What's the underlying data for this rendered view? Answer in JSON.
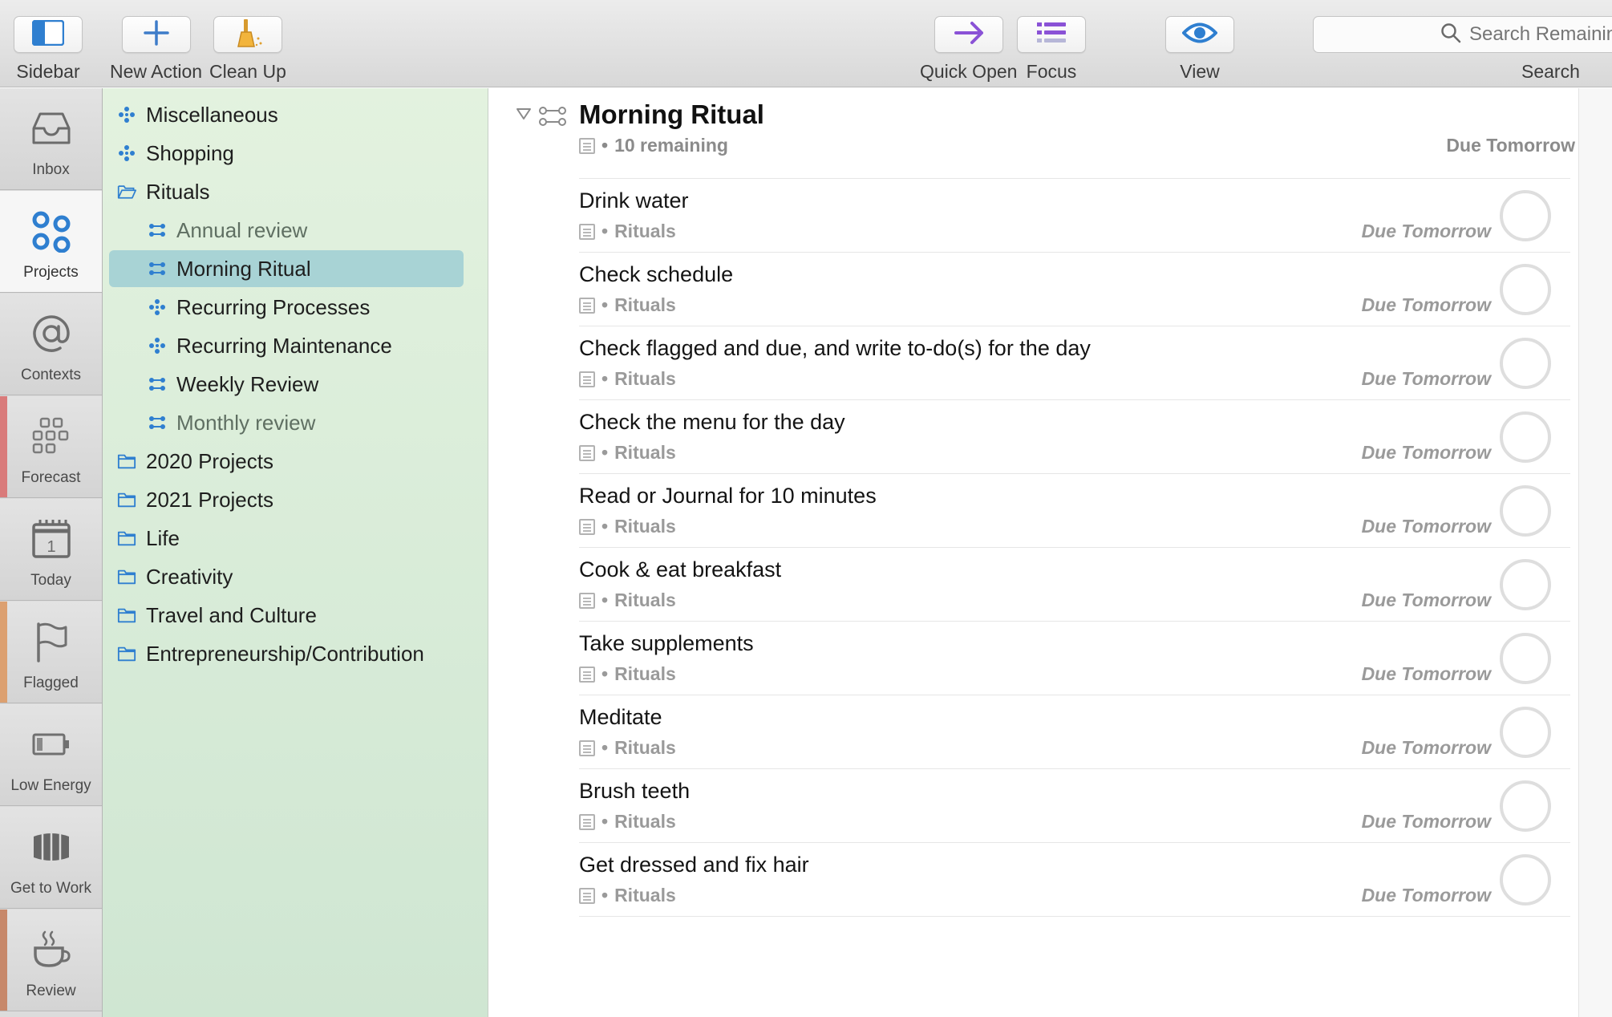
{
  "toolbar": {
    "sidebar_label": "Sidebar",
    "new_action_label": "New Action",
    "clean_up_label": "Clean Up",
    "quick_open_label": "Quick Open",
    "focus_label": "Focus",
    "view_label": "View",
    "search_placeholder": "Search Remaining",
    "search_label": "Search"
  },
  "perspectives": [
    {
      "label": "Inbox",
      "icon": "inbox-icon"
    },
    {
      "label": "Projects",
      "icon": "projects-icon",
      "active": true
    },
    {
      "label": "Contexts",
      "icon": "at-sign-icon"
    },
    {
      "label": "Forecast",
      "icon": "grid-icon",
      "color": "#d97b7b"
    },
    {
      "label": "Today",
      "icon": "calendar-icon"
    },
    {
      "label": "Flagged",
      "icon": "flag-icon",
      "color": "#dca070"
    },
    {
      "label": "Low Energy",
      "icon": "battery-icon"
    },
    {
      "label": "Get to Work",
      "icon": "cylinder-icon"
    },
    {
      "label": "Review",
      "icon": "coffee-cup-icon",
      "color": "#c7886a"
    }
  ],
  "sidebar": {
    "items": [
      {
        "label": "Miscellaneous",
        "icon": "parallel-project-icon"
      },
      {
        "label": "Shopping",
        "icon": "parallel-project-icon"
      },
      {
        "label": "Rituals",
        "icon": "folder-open-icon"
      },
      {
        "label": "Annual review",
        "icon": "sequential-project-icon",
        "dim": true
      },
      {
        "label": "Morning Ritual",
        "icon": "sequential-project-icon",
        "selected": true
      },
      {
        "label": "Recurring Processes",
        "icon": "parallel-project-icon"
      },
      {
        "label": "Recurring Maintenance",
        "icon": "parallel-project-icon"
      },
      {
        "label": "Weekly Review",
        "icon": "sequential-project-icon"
      },
      {
        "label": "Monthly review",
        "icon": "sequential-project-icon",
        "dim": true
      },
      {
        "label": "2020 Projects",
        "icon": "folder-icon"
      },
      {
        "label": "2021 Projects",
        "icon": "folder-icon"
      },
      {
        "label": "Life",
        "icon": "folder-icon"
      },
      {
        "label": "Creativity",
        "icon": "folder-icon"
      },
      {
        "label": "Travel and Culture",
        "icon": "folder-icon"
      },
      {
        "label": "Entrepreneurship/Contribution",
        "icon": "folder-icon"
      }
    ]
  },
  "project": {
    "title": "Morning Ritual",
    "remaining": "10 remaining",
    "due": "Due Tomorrow"
  },
  "tasks": [
    {
      "title": "Drink water",
      "context": "Rituals",
      "due": "Due Tomorrow"
    },
    {
      "title": "Check schedule",
      "context": "Rituals",
      "due": "Due Tomorrow"
    },
    {
      "title": "Check flagged and due, and write to-do(s) for the day",
      "context": "Rituals",
      "due": "Due Tomorrow"
    },
    {
      "title": "Check the menu for the day",
      "context": "Rituals",
      "due": "Due Tomorrow"
    },
    {
      "title": "Read or Journal for 10 minutes",
      "context": "Rituals",
      "due": "Due Tomorrow"
    },
    {
      "title": "Cook & eat breakfast",
      "context": "Rituals",
      "due": "Due Tomorrow"
    },
    {
      "title": "Take supplements",
      "context": "Rituals",
      "due": "Due Tomorrow"
    },
    {
      "title": "Meditate",
      "context": "Rituals",
      "due": "Due Tomorrow"
    },
    {
      "title": "Brush teeth",
      "context": "Rituals",
      "due": "Due Tomorrow"
    },
    {
      "title": "Get dressed and fix hair",
      "context": "Rituals",
      "due": "Due Tomorrow"
    }
  ],
  "colors": {
    "accent_blue": "#2f7fd0",
    "purple": "#8a52d6",
    "sidebar_selected": "#a8d3d5"
  }
}
